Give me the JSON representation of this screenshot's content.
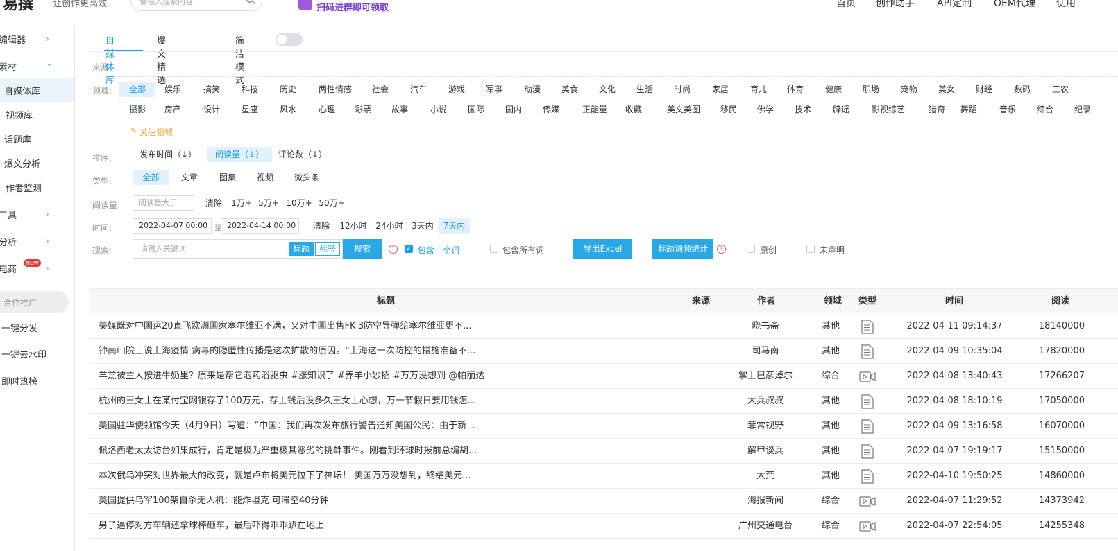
{
  "header": {
    "logo": "易撰",
    "slogan": "让创作更高效",
    "search_placeholder": "请输入搜索内容",
    "promo": "扫码进群即可领取",
    "nav": [
      "首页",
      "创作助手",
      "API定制",
      "OEM代理",
      "使用"
    ]
  },
  "sidebar": {
    "items": [
      {
        "label": "编辑器",
        "chevron": "›"
      },
      {
        "label": "素材",
        "chevron": "⌄"
      },
      {
        "label": "自媒体库",
        "active": true
      },
      {
        "label": "视频库"
      },
      {
        "label": "话题库"
      },
      {
        "label": "爆文分析"
      },
      {
        "label": "作者监测"
      },
      {
        "label": "工具",
        "chevron": "›"
      },
      {
        "label": "分析",
        "chevron": "›"
      },
      {
        "label": "电商",
        "chevron": "›",
        "badge": "NEW"
      },
      {
        "label": "合作推广"
      },
      {
        "label": "一键分发"
      },
      {
        "label": "一键去水印"
      },
      {
        "label": "即时热榜"
      }
    ]
  },
  "tabs": {
    "tab1": "自媒体库",
    "tab2": "爆文精选",
    "simple_mode": "简洁模式"
  },
  "filters": {
    "source_label": "来源:",
    "domain_label": "领域:",
    "domains_row1": [
      "全部",
      "娱乐",
      "搞笑",
      "科技",
      "历史",
      "两性情感",
      "社会",
      "汽车",
      "游戏",
      "军事",
      "动漫",
      "美食",
      "文化",
      "生活",
      "时尚",
      "家居",
      "育儿",
      "体育",
      "健康",
      "职场",
      "宠物",
      "美女",
      "财经",
      "数码",
      "三农"
    ],
    "domains_row2": [
      "摄影",
      "房产",
      "设计",
      "星座",
      "风水",
      "心理",
      "彩票",
      "故事",
      "小说",
      "国际",
      "国内",
      "传媒",
      "正能量",
      "收藏",
      "美文美图",
      "移民",
      "佛学",
      "技术",
      "辟谣",
      "影视综艺",
      "猎奇",
      "舞蹈",
      "音乐",
      "综合",
      "纪录"
    ],
    "follow_domain": "关注领域",
    "sort_label": "排序:",
    "sort_options": [
      "发布时间（↓）",
      "阅读量（↓）",
      "评论数（↓）"
    ],
    "type_label": "类型:",
    "types": [
      "全部",
      "文章",
      "图集",
      "视频",
      "微头条"
    ],
    "reads_label": "阅读量:",
    "reads_placeholder": "阅读量大于",
    "reads_clear": "清除",
    "reads_options": [
      "1万+",
      "5万+",
      "10万+",
      "50万+"
    ],
    "time_label": "时间:",
    "time_from": "2022-04-07 00:00",
    "time_to_sep": "至",
    "time_to": "2022-04-14 00:00",
    "time_clear": "清除",
    "time_options": [
      "12小时",
      "24小时",
      "3天内",
      "7天内"
    ],
    "search_label": "搜索:",
    "search_placeholder": "请输入关键词",
    "scope_title": "标题",
    "scope_tag": "标签",
    "search_button": "搜索",
    "contains_one": "包含一个词",
    "contains_all": "包含所有词",
    "export_excel": "导出Excel",
    "title_stats": "标题词频统计",
    "original": "原创",
    "undeclared": "未声明"
  },
  "table": {
    "headers": [
      "标题",
      "来源",
      "作者",
      "领域",
      "类型",
      "时间",
      "阅读"
    ],
    "rows": [
      {
        "title": "美媒既对中国运20直飞欧洲国家塞尔维亚不满，又对中国出售FK-3防空导弹给塞尔维亚更不...",
        "author": "晓书斋",
        "domain": "其他",
        "type": "article",
        "time": "2022-04-11 09:14:37",
        "reads": "18140000"
      },
      {
        "title": "钟南山院士说上海疫情 病毒的隐匿性传播是这次扩散的原因。“上海这一次防控的措施准备不...",
        "author": "司马南",
        "domain": "其他",
        "type": "article",
        "time": "2022-04-09 10:35:04",
        "reads": "17820000"
      },
      {
        "title": "羊羔被主人按进牛奶里？原来是帮它泡药浴驱虫 #涨知识了 #养羊小妙招 #万万没想到 @帕丽达",
        "author": "掌上巴彦淖尔",
        "domain": "综合",
        "type": "video",
        "time": "2022-04-08 13:40:43",
        "reads": "17266207"
      },
      {
        "title": "杭州的王女士在某付宝网银存了100万元，存上钱后没多久王女士心想，万一节假日要用钱怎...",
        "author": "大兵叔叔",
        "domain": "其他",
        "type": "article",
        "time": "2022-04-08 18:10:19",
        "reads": "17050000"
      },
      {
        "title": "美国驻华使领馆今天（4月9日）写道：“中国：我们再次发布旅行警告通知美国公民：由于新...",
        "author": "菲常视野",
        "domain": "其他",
        "type": "article",
        "time": "2022-04-09 13:16:58",
        "reads": "16070000"
      },
      {
        "title": "佩洛西老太太访台如果成行，肯定是极为严重极其恶劣的挑衅事件。刚看到环球时报前总编胡...",
        "author": "解甲谈兵",
        "domain": "其他",
        "type": "article",
        "time": "2022-04-07 19:19:17",
        "reads": "15150000"
      },
      {
        "title": "本次俄乌冲突对世界最大的改变，就是卢布将美元拉下了神坛！ 美国万万没想到，终结美元...",
        "author": "大荒",
        "domain": "其他",
        "type": "article",
        "time": "2022-04-10 19:50:25",
        "reads": "14860000"
      },
      {
        "title": "美国提供乌军100架自杀无人机：能炸坦克 可滞空40分钟",
        "author": "海报新闻",
        "domain": "综合",
        "type": "video",
        "time": "2022-04-07 11:29:52",
        "reads": "14373942"
      },
      {
        "title": "男子逼停对方车辆还拿球棒砸车，最后吓得乖乖趴在地上",
        "author": "广州交通电台",
        "domain": "综合",
        "type": "video",
        "time": "2022-04-07 22:54:05",
        "reads": "14255348"
      }
    ]
  }
}
